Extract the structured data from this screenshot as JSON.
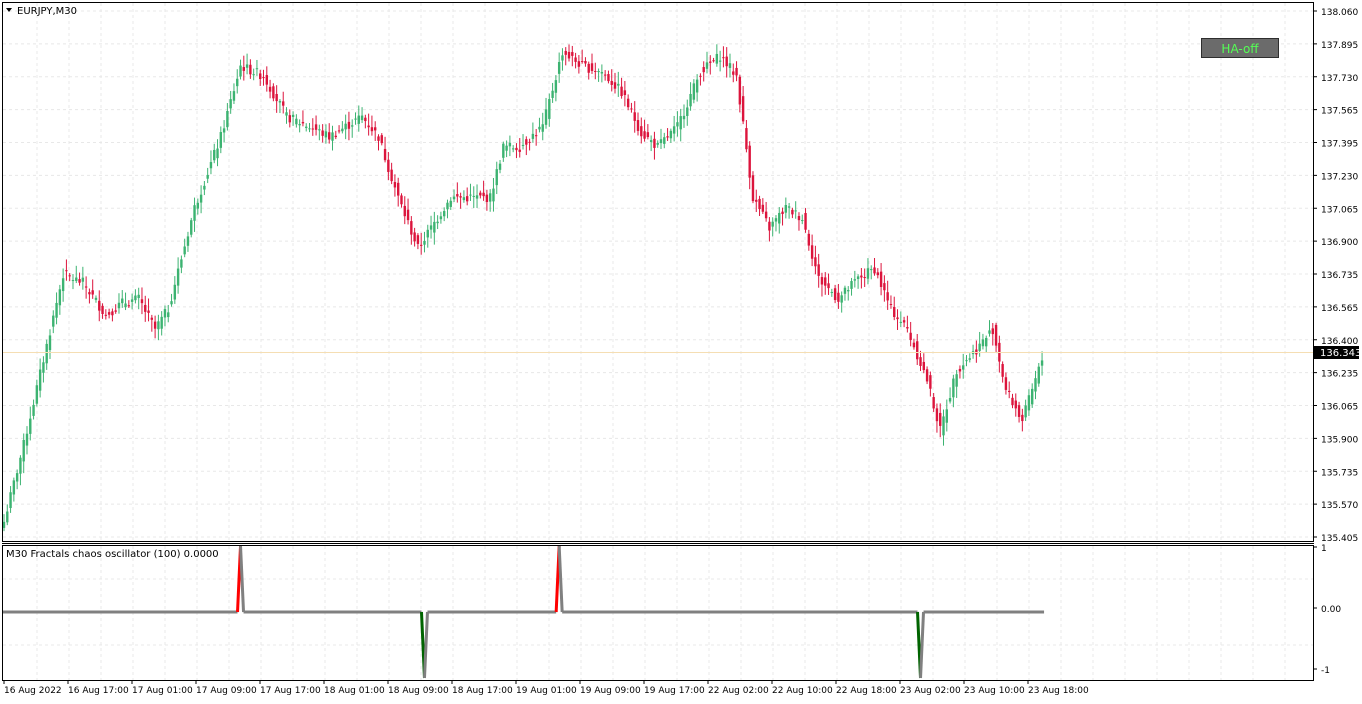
{
  "main_chart": {
    "symbol_label": "EURJPY,M30",
    "menu_icon": "triangle-down-icon",
    "current_price": "136.343",
    "price_ticks": [
      "138.060",
      "137.895",
      "137.730",
      "137.565",
      "137.395",
      "137.230",
      "137.065",
      "136.900",
      "136.735",
      "136.565",
      "136.400",
      "136.235",
      "136.065",
      "135.900",
      "135.735",
      "135.570",
      "135.405"
    ],
    "colors": {
      "bull": "#3cb371",
      "bear": "#dc143c",
      "grid": "#e8e8e8",
      "price_line": "#f5deb3",
      "price_tag_bg": "#000000"
    }
  },
  "ha_button": {
    "label": "HA-off"
  },
  "indicator": {
    "label": "M30 Fractals chaos oscillator (100) 0.0000",
    "ticks": [
      "1",
      "0.00",
      "-1"
    ],
    "colors": {
      "line": "#808080",
      "up": "#ff0000",
      "down": "#006400"
    }
  },
  "time_axis": {
    "labels": [
      "16 Aug 2022",
      "16 Aug 17:00",
      "17 Aug 01:00",
      "17 Aug 09:00",
      "17 Aug 17:00",
      "18 Aug 01:00",
      "18 Aug 09:00",
      "18 Aug 17:00",
      "19 Aug 01:00",
      "19 Aug 09:00",
      "19 Aug 17:00",
      "22 Aug 02:00",
      "22 Aug 10:00",
      "22 Aug 18:00",
      "23 Aug 02:00",
      "23 Aug 10:00",
      "23 Aug 18:00"
    ]
  },
  "chart_data": [
    {
      "type": "candlestick",
      "title": "EURJPY,M30",
      "ylim": [
        135.405,
        138.06
      ],
      "close_anchors": [
        {
          "i": 0,
          "c": 135.5
        },
        {
          "i": 6,
          "c": 135.88
        },
        {
          "i": 12,
          "c": 136.3
        },
        {
          "i": 18,
          "c": 136.72
        },
        {
          "i": 24,
          "c": 136.68
        },
        {
          "i": 31,
          "c": 136.52
        },
        {
          "i": 36,
          "c": 136.58
        },
        {
          "i": 41,
          "c": 136.6
        },
        {
          "i": 46,
          "c": 136.45
        },
        {
          "i": 50,
          "c": 136.55
        },
        {
          "i": 58,
          "c": 137.05
        },
        {
          "i": 66,
          "c": 137.4
        },
        {
          "i": 72,
          "c": 137.75
        },
        {
          "i": 79,
          "c": 137.7
        },
        {
          "i": 86,
          "c": 137.5
        },
        {
          "i": 93,
          "c": 137.45
        },
        {
          "i": 99,
          "c": 137.4
        },
        {
          "i": 104,
          "c": 137.45
        },
        {
          "i": 109,
          "c": 137.5
        },
        {
          "i": 114,
          "c": 137.4
        },
        {
          "i": 120,
          "c": 137.1
        },
        {
          "i": 126,
          "c": 136.85
        },
        {
          "i": 130,
          "c": 136.95
        },
        {
          "i": 136,
          "c": 137.1
        },
        {
          "i": 142,
          "c": 137.1
        },
        {
          "i": 148,
          "c": 137.1
        },
        {
          "i": 152,
          "c": 137.35
        },
        {
          "i": 157,
          "c": 137.35
        },
        {
          "i": 164,
          "c": 137.45
        },
        {
          "i": 170,
          "c": 137.82
        },
        {
          "i": 176,
          "c": 137.75
        },
        {
          "i": 182,
          "c": 137.72
        },
        {
          "i": 188,
          "c": 137.62
        },
        {
          "i": 194,
          "c": 137.42
        },
        {
          "i": 199,
          "c": 137.35
        },
        {
          "i": 205,
          "c": 137.45
        },
        {
          "i": 212,
          "c": 137.72
        },
        {
          "i": 218,
          "c": 137.8
        },
        {
          "i": 223,
          "c": 137.7
        },
        {
          "i": 228,
          "c": 137.1
        },
        {
          "i": 233,
          "c": 136.95
        },
        {
          "i": 238,
          "c": 137.05
        },
        {
          "i": 243,
          "c": 137.0
        },
        {
          "i": 248,
          "c": 136.7
        },
        {
          "i": 254,
          "c": 136.6
        },
        {
          "i": 260,
          "c": 136.7
        },
        {
          "i": 265,
          "c": 136.75
        },
        {
          "i": 270,
          "c": 136.55
        },
        {
          "i": 275,
          "c": 136.45
        },
        {
          "i": 281,
          "c": 136.2
        },
        {
          "i": 285,
          "c": 135.95
        },
        {
          "i": 290,
          "c": 136.25
        },
        {
          "i": 296,
          "c": 136.35
        },
        {
          "i": 301,
          "c": 136.45
        },
        {
          "i": 305,
          "c": 136.15
        },
        {
          "i": 310,
          "c": 136.0
        },
        {
          "i": 316,
          "c": 136.3
        }
      ]
    },
    {
      "type": "line",
      "title": "M30 Fractals chaos oscillator (100) 0.0000",
      "ylim": [
        -1,
        1
      ],
      "baseline": 0,
      "spikes": [
        {
          "i": 72,
          "value": 1
        },
        {
          "i": 128,
          "value": -1
        },
        {
          "i": 169,
          "value": 1
        },
        {
          "i": 279,
          "value": -1
        }
      ]
    }
  ]
}
